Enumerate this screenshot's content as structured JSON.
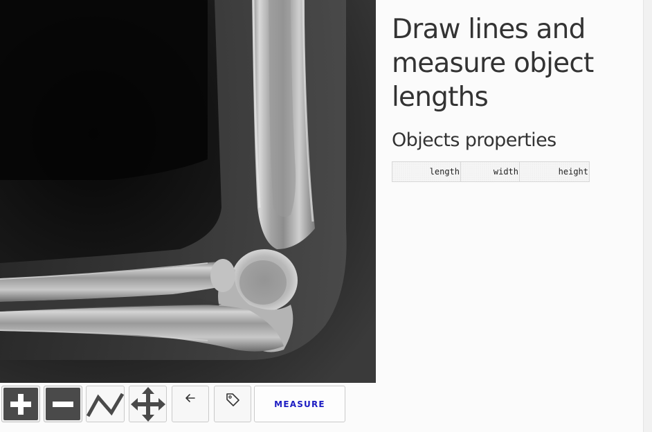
{
  "viewer": {
    "image_alt": "Elbow X-ray lateral view"
  },
  "toolbar": {
    "zoom_in_icon": "plus-icon",
    "zoom_out_icon": "minus-icon",
    "draw_line_icon": "polyline-icon",
    "pan_icon": "move-arrows-icon",
    "undo_icon": "arrow-left-icon",
    "label_icon": "tag-icon",
    "measure_label": "MEASURE"
  },
  "panel": {
    "title": "Draw lines and measure object lengths",
    "subtitle": "Objects properties",
    "table": {
      "columns": [
        "length",
        "width",
        "height"
      ]
    }
  },
  "colors": {
    "accent": "#1c1cc2",
    "tool_dark": "#4a4a4a",
    "background": "#fbfbfb"
  }
}
